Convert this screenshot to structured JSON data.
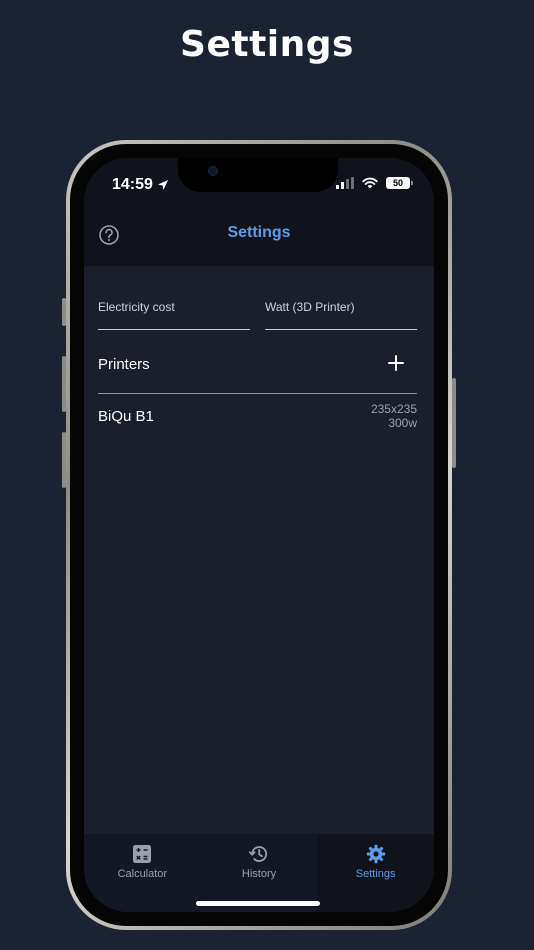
{
  "page": {
    "heading": "Settings"
  },
  "status_bar": {
    "time": "14:59",
    "battery_level": "50"
  },
  "nav": {
    "title": "Settings",
    "help_icon": "question-circle-icon"
  },
  "settings": {
    "electricity_cost": {
      "placeholder": "Electricity cost",
      "value": ""
    },
    "watt": {
      "placeholder": "Watt (3D Printer)",
      "value": ""
    }
  },
  "printers": {
    "label": "Printers",
    "add_icon": "plus-icon",
    "items": [
      {
        "name": "BiQu B1",
        "size": "235x235",
        "power": "300w"
      }
    ]
  },
  "tabbar": {
    "tabs": [
      {
        "label": "Calculator",
        "icon": "calculator-icon",
        "active": false
      },
      {
        "label": "History",
        "icon": "history-icon",
        "active": false
      },
      {
        "label": "Settings",
        "icon": "gear-icon",
        "active": true
      }
    ]
  },
  "colors": {
    "accent": "#5b9de8",
    "background": "#1b2231",
    "screen_bg": "#1b1f2c",
    "bar_bg": "#10131c"
  }
}
